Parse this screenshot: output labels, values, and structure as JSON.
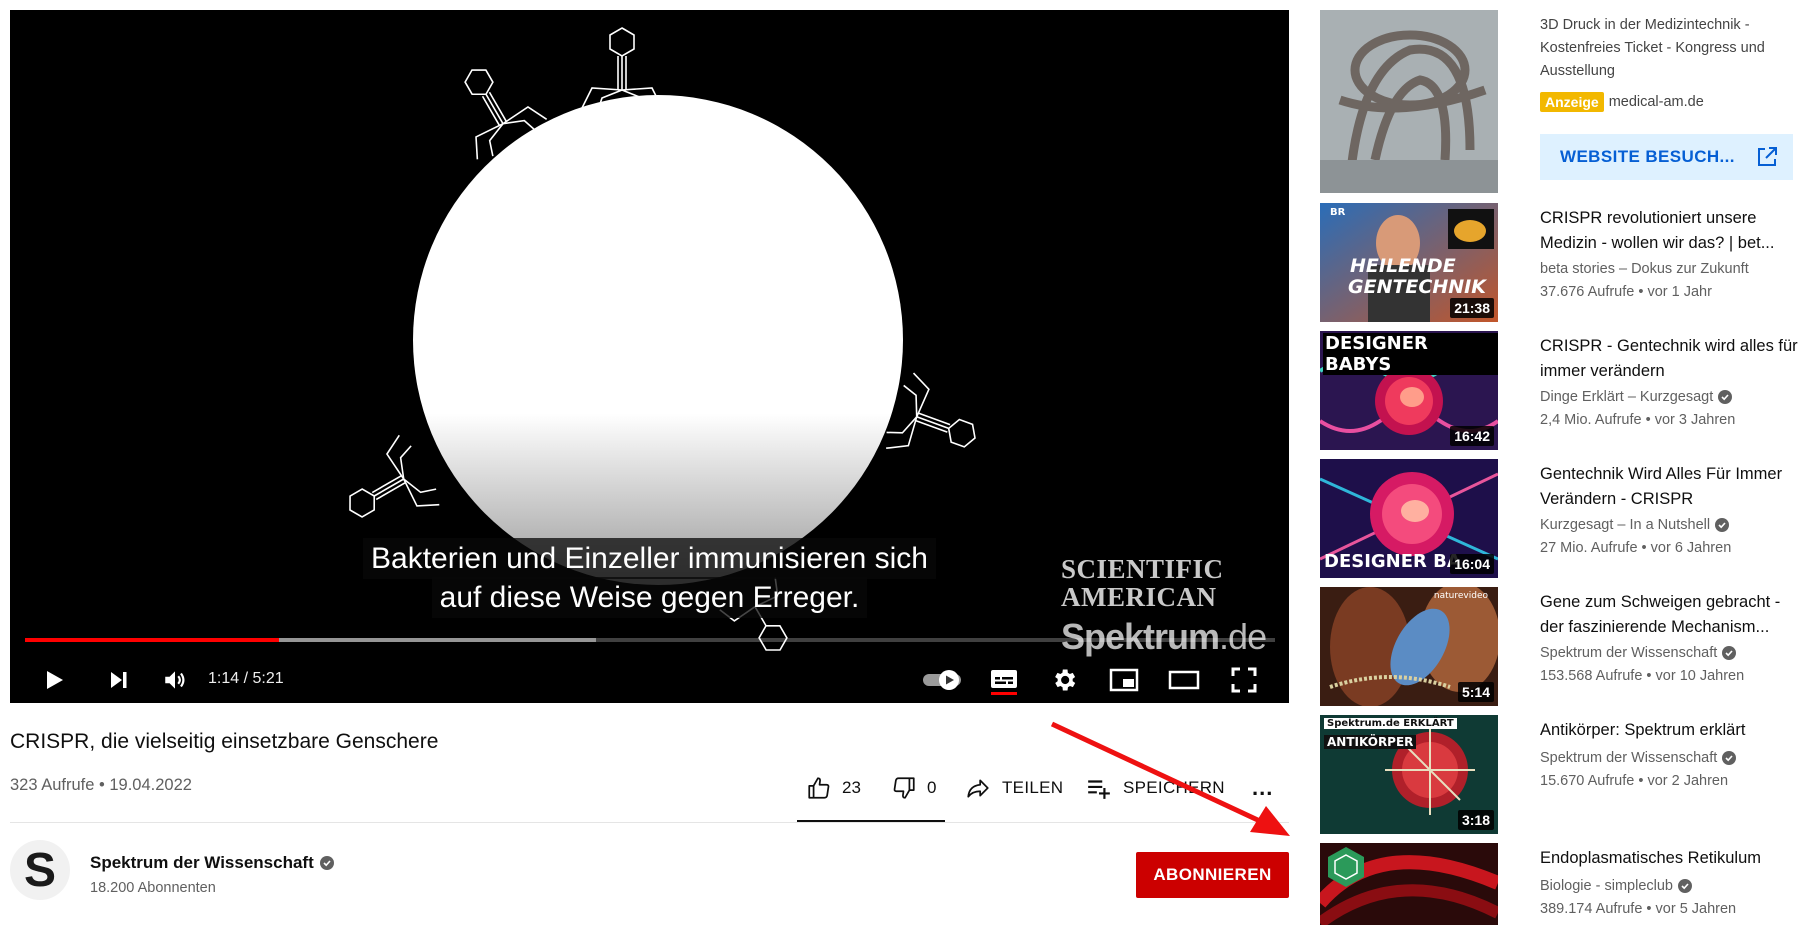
{
  "player": {
    "subtitle_line1": "Bakterien und Einzeller immunisieren sich",
    "subtitle_line2": "auf diese Weise gegen Erreger.",
    "watermark_line1": "SCIENTIFIC",
    "watermark_line2": "AMERICAN",
    "watermark_brand": "Spektrum",
    "watermark_tld": ".de",
    "time": "1:14 / 5:21",
    "progress_played_fraction": 0.203,
    "progress_buffered_fraction": 0.457
  },
  "video": {
    "title": "CRISPR, die vielseitig einsetzbare Genschere",
    "meta": "323 Aufrufe • 19.04.2022",
    "likes": "23",
    "dislikes": "0",
    "share_label": "TEILEN",
    "save_label": "SPEICHERN",
    "more_label": "..."
  },
  "channel": {
    "avatar_letter": "S",
    "name": "Spektrum der Wissenschaft",
    "subscribers": "18.200 Abonnenten",
    "subscribe_label": "ABONNIEREN"
  },
  "ad": {
    "title": "3D Druck in der Medizintechnik - Kostenfreies Ticket - Kongress und Ausstellung",
    "badge": "Anzeige",
    "domain": "medical-am.de",
    "button_label": "WEBSITE BESUCH..."
  },
  "recommendations": [
    {
      "title": "CRISPR revolutioniert unsere Medizin - wollen wir das? | bet...",
      "channel": "beta stories – Dokus zur Zukunft",
      "verified": false,
      "stats": "37.676 Aufrufe • vor 1 Jahr",
      "duration": "21:38",
      "thumb_text1": "HEILENDE",
      "thumb_text2": "GENTECHNIK",
      "thumb_tag": "BR"
    },
    {
      "title": "CRISPR - Gentechnik wird alles für immer verändern",
      "channel": "Dinge Erklärt – Kurzgesagt",
      "verified": true,
      "stats": "2,4 Mio. Aufrufe • vor 3 Jahren",
      "duration": "16:42",
      "thumb_text1": "DESIGNER BABYS"
    },
    {
      "title": "Gentechnik Wird Alles Für Immer Verändern - CRISPR",
      "channel": "Kurzgesagt – In a Nutshell",
      "verified": true,
      "stats": "27 Mio. Aufrufe • vor 6 Jahren",
      "duration": "16:04",
      "thumb_text1": "DESIGNER BA"
    },
    {
      "title": "Gene zum Schweigen gebracht - der faszinierende Mechanism...",
      "channel": "Spektrum der Wissenschaft",
      "verified": true,
      "stats": "153.568 Aufrufe • vor 10 Jahren",
      "duration": "5:14",
      "thumb_tag": "naturevideo"
    },
    {
      "title": "Antikörper: Spektrum erklärt",
      "channel": "Spektrum der Wissenschaft",
      "verified": true,
      "stats": "15.670 Aufrufe • vor 2 Jahren",
      "duration": "3:18",
      "thumb_text1": "ANTIKÖRPER",
      "thumb_tag": "Spektrum.de ERKLÄRT"
    },
    {
      "title": "Endoplasmatisches Retikulum",
      "channel": "Biologie - simpleclub",
      "verified": true,
      "stats": "389.174 Aufrufe • vor 5 Jahren"
    }
  ],
  "colors": {
    "accent_red": "#cc0000",
    "progress_red": "#ff0000",
    "ad_badge": "#f2b800",
    "ad_button_bg": "#def1ff",
    "ad_button_text": "#065fd4"
  }
}
